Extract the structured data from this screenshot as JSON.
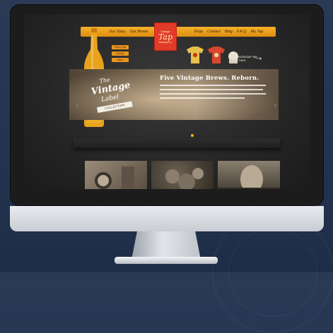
{
  "site": {
    "nav_left": [
      "Our Story",
      "Our Brews"
    ],
    "nav_right": [
      "Shop",
      "Contact",
      "Blog",
      "F.A.Q",
      "My Tap"
    ],
    "logo": {
      "top": "Vintage",
      "main": "Tap",
      "bottom": "Brewing Co."
    },
    "side_buttons": [
      "Find a Tap",
      "Events",
      "Store"
    ],
    "promo_text": "Buy exclusive Tap gear here.",
    "hero": {
      "badge_the": "The",
      "badge_vintage": "Vintage",
      "badge_label": "Label",
      "badge_ribbon": "COLLECTION",
      "title": "Five Vintage Brews. Reborn."
    }
  },
  "colors": {
    "accent_orange": "#f5b22a",
    "logo_red": "#e23b2a",
    "background_navy": "#243450"
  },
  "icons": {
    "left_arrow": "chevron-left-icon",
    "right_arrow": "chevron-right-icon",
    "promo_arrow": "arrow-icon"
  }
}
